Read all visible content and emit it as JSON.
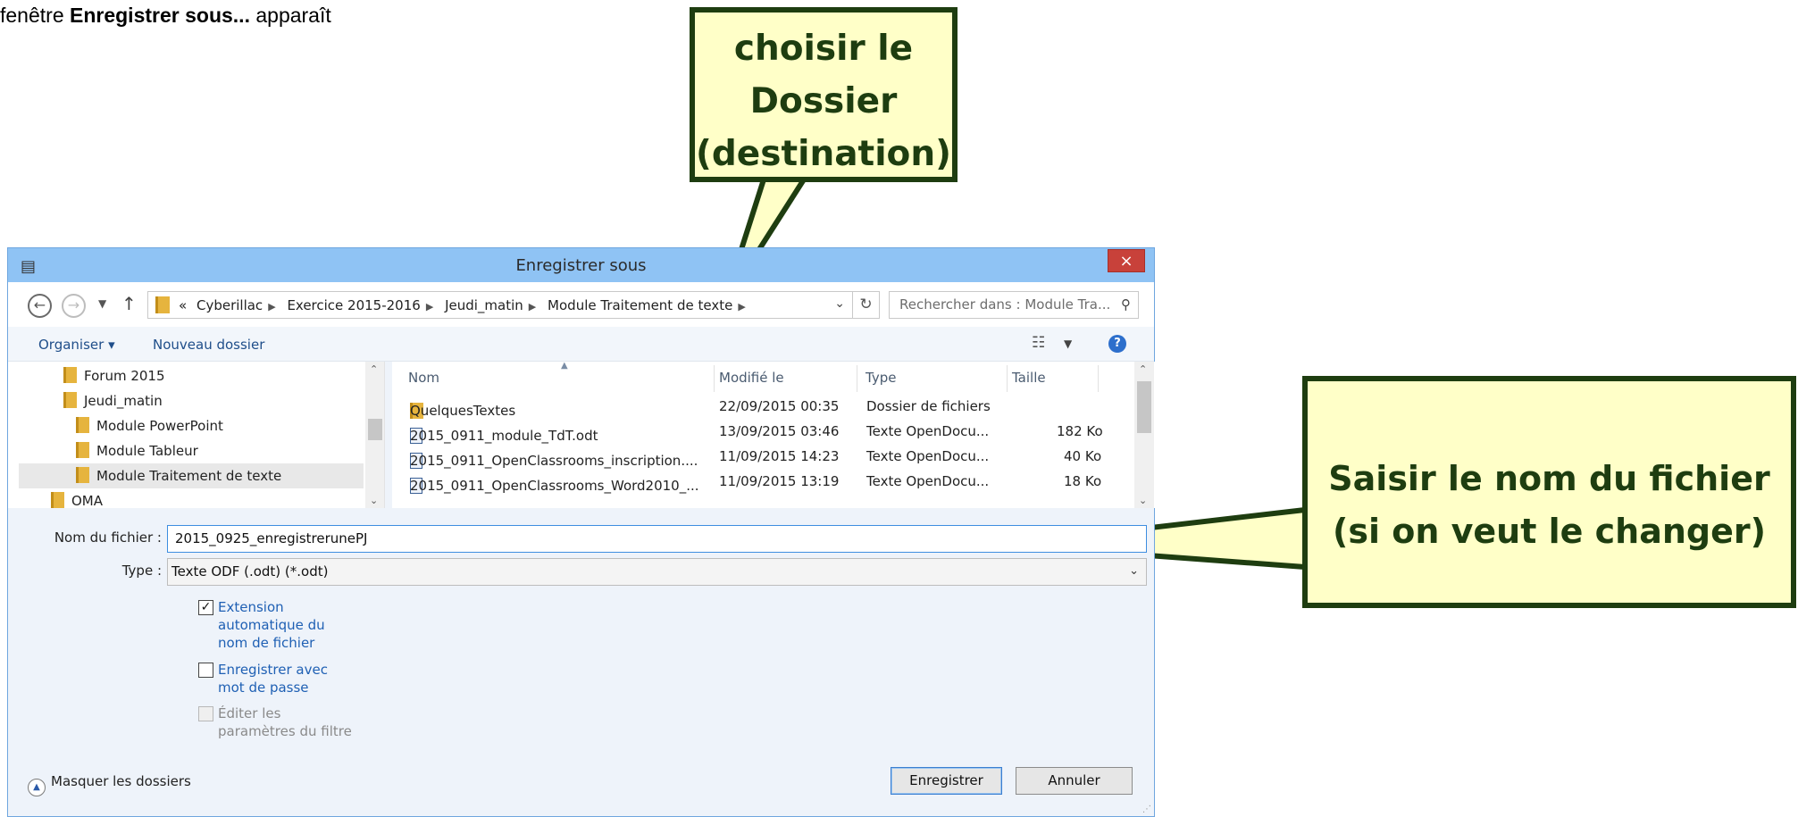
{
  "caption": {
    "prefix": "fenêtre ",
    "bold": "Enregistrer sous...",
    "suffix": " apparaît"
  },
  "callouts": {
    "folder": [
      "choisir le",
      "Dossier",
      "(destination)"
    ],
    "filename": [
      "Saisir le nom du fichier",
      "(si on veut le changer)"
    ]
  },
  "dialog": {
    "title": "Enregistrer sous",
    "close": "×",
    "breadcrumb": [
      "«",
      "Cyberillac",
      "Exercice 2015-2016",
      "Jeudi_matin",
      "Module Traitement de texte"
    ],
    "search_placeholder": "Rechercher dans : Module Tra...",
    "toolbar": {
      "organize": "Organiser ▾",
      "new_folder": "Nouveau dossier"
    },
    "tree": [
      {
        "label": "Forum 2015",
        "indent": 1
      },
      {
        "label": "Jeudi_matin",
        "indent": 1
      },
      {
        "label": "Module PowerPoint",
        "indent": 2
      },
      {
        "label": "Module Tableur",
        "indent": 2
      },
      {
        "label": "Module Traitement de texte",
        "indent": 2,
        "selected": true
      },
      {
        "label": "OMA",
        "indent": 0
      }
    ],
    "columns": [
      "Nom",
      "Modifié le",
      "Type",
      "Taille"
    ],
    "files": [
      {
        "name": "QuelquesTextes",
        "date": "22/09/2015 00:35",
        "type": "Dossier de fichiers",
        "size": "",
        "kind": "folder"
      },
      {
        "name": "2015_0911_module_TdT.odt",
        "date": "13/09/2015 03:46",
        "type": "Texte OpenDocu...",
        "size": "182 Ko",
        "kind": "doc"
      },
      {
        "name": "2015_0911_OpenClassrooms_inscription....",
        "date": "11/09/2015 14:23",
        "type": "Texte OpenDocu...",
        "size": "40 Ko",
        "kind": "doc"
      },
      {
        "name": "2015_0911_OpenClassrooms_Word2010_...",
        "date": "11/09/2015 13:19",
        "type": "Texte OpenDocu...",
        "size": "18 Ko",
        "kind": "doc"
      }
    ],
    "filename_label": "Nom du fichier :",
    "filename_value": "2015_0925_enregistrerunePJ",
    "type_label": "Type :",
    "type_value": "Texte ODF (.odt) (*.odt)",
    "options": [
      {
        "label": "Extension automatique du nom de fichier",
        "checked": true,
        "disabled": false
      },
      {
        "label": "Enregistrer avec mot de passe",
        "checked": false,
        "disabled": false
      },
      {
        "label": "Éditer les paramètres du filtre",
        "checked": false,
        "disabled": true
      }
    ],
    "hide_folders": "Masquer les dossiers",
    "save": "Enregistrer",
    "cancel": "Annuler"
  }
}
